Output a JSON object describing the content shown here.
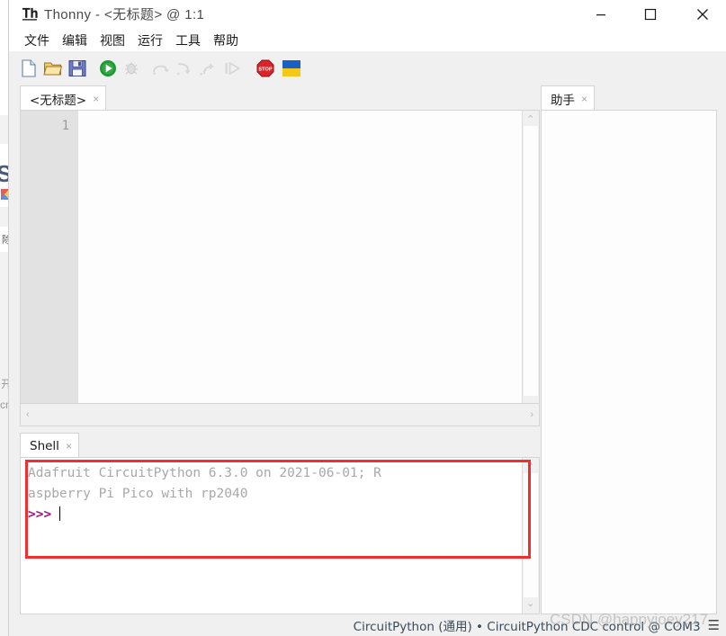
{
  "window": {
    "title": "Thonny  -  <无标题>  @  1:1",
    "app_icon": "thonny-logo-icon",
    "controls": {
      "minimize": "minimize-icon",
      "maximize": "maximize-icon",
      "close": "close-icon"
    }
  },
  "menu": {
    "items": [
      {
        "label": "文件"
      },
      {
        "label": "编辑"
      },
      {
        "label": "视图"
      },
      {
        "label": "运行"
      },
      {
        "label": "工具"
      },
      {
        "label": "帮助"
      }
    ]
  },
  "toolbar": {
    "buttons": [
      {
        "name": "new-file-icon",
        "label": "新建",
        "enabled": true
      },
      {
        "name": "open-file-icon",
        "label": "打开",
        "enabled": true
      },
      {
        "name": "save-file-icon",
        "label": "保存",
        "enabled": true
      },
      {
        "name": "run-icon",
        "label": "运行",
        "enabled": true
      },
      {
        "name": "debug-icon",
        "label": "调试",
        "enabled": false
      },
      {
        "name": "step-over-icon",
        "label": "跳过",
        "enabled": false
      },
      {
        "name": "step-into-icon",
        "label": "步入",
        "enabled": false
      },
      {
        "name": "step-out-icon",
        "label": "步出",
        "enabled": false
      },
      {
        "name": "resume-icon",
        "label": "继续",
        "enabled": false
      },
      {
        "name": "stop-icon",
        "label": "停止",
        "enabled": true
      },
      {
        "name": "ukraine-flag-icon",
        "label": "Ukraine",
        "enabled": true
      }
    ]
  },
  "editor": {
    "tab": {
      "label": "<无标题>",
      "close": "×"
    },
    "gutter": {
      "line_numbers": [
        "1"
      ]
    },
    "content": "",
    "scroll": {
      "up_arrow": "⌃",
      "down_arrow": "⌄",
      "left_arrow": "‹",
      "right_arrow": "›"
    }
  },
  "shell": {
    "tab": {
      "label": "Shell",
      "close": "×"
    },
    "output_line_1": "Adafruit CircuitPython 6.3.0 on 2021-06-01; R",
    "output_line_2": "aspberry Pi Pico with rp2040",
    "prompt": ">>>",
    "input_value": "",
    "scroll": {
      "up_arrow": "⌃",
      "down_arrow": "⌄"
    }
  },
  "assistant": {
    "tab": {
      "label": "助手",
      "close": "×"
    },
    "content": "",
    "scroll": {
      "up_arrow": "⌃",
      "down_arrow": "⌄"
    }
  },
  "status_bar": {
    "text": "CircuitPython (通用)  •  CircuitPython CDC control @ COM3",
    "menu_icon": "☰"
  },
  "annotation": {
    "type": "red-rectangle-highlight",
    "color": "#f03030"
  },
  "watermark": {
    "text": "CSDN @happyjoey217"
  },
  "background_window": {
    "glyph": "S",
    "text_1": "除",
    "text_2": "开",
    "text_3": "cn"
  },
  "colors": {
    "accent_prompt": "#9b1b87",
    "annotation_red": "#f03030",
    "title_text": "#4a4a4a",
    "status_text": "#3b4a5a",
    "shell_output": "#a8a8a8",
    "gutter_bg": "#e2e2e2"
  }
}
